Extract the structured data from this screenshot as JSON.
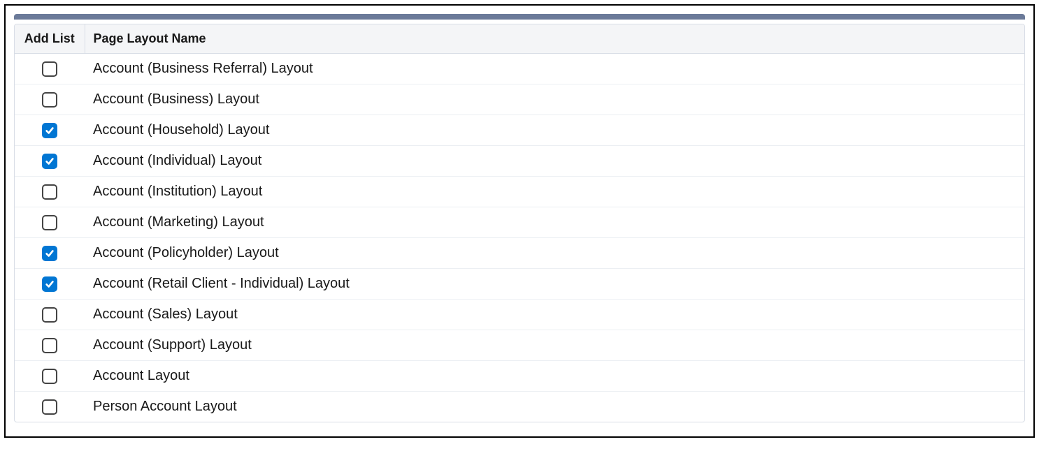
{
  "table": {
    "headers": {
      "add_list": "Add List",
      "page_layout_name": "Page Layout Name"
    },
    "rows": [
      {
        "checked": false,
        "name": "Account (Business Referral) Layout"
      },
      {
        "checked": false,
        "name": "Account (Business) Layout"
      },
      {
        "checked": true,
        "name": "Account (Household) Layout"
      },
      {
        "checked": true,
        "name": "Account (Individual) Layout"
      },
      {
        "checked": false,
        "name": "Account (Institution) Layout"
      },
      {
        "checked": false,
        "name": "Account (Marketing) Layout"
      },
      {
        "checked": true,
        "name": "Account (Policyholder) Layout"
      },
      {
        "checked": true,
        "name": "Account (Retail Client - Individual) Layout"
      },
      {
        "checked": false,
        "name": "Account (Sales) Layout"
      },
      {
        "checked": false,
        "name": "Account (Support) Layout"
      },
      {
        "checked": false,
        "name": "Account Layout"
      },
      {
        "checked": false,
        "name": "Person Account Layout"
      }
    ]
  }
}
